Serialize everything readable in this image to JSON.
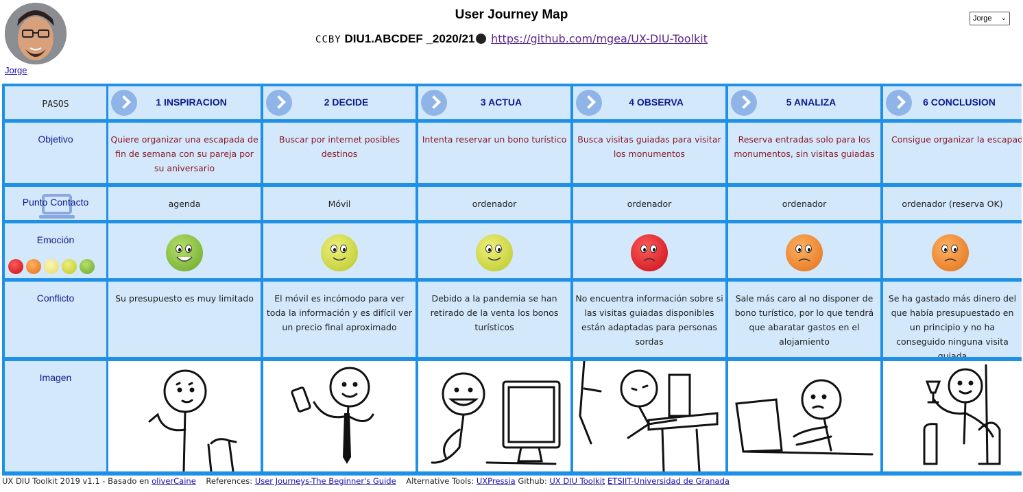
{
  "user": {
    "name": "Jorge",
    "selected": "Jorge"
  },
  "header": {
    "title": "User Journey Map",
    "cc": "CCBY",
    "code": "DIU1.ABCDEF _2020/21",
    "repo_link": "https://github.com/mgea/UX-DIU-Toolkit"
  },
  "rows": {
    "pasos": "PASOS",
    "objetivo": "Objetivo",
    "punto_contacto": "Punto Contacto",
    "emocion": "Emoción",
    "conflicto": "Conflicto",
    "imagen": "Imagen"
  },
  "steps": [
    {
      "label": "1 INSPIRACION",
      "objetivo": "Quiere organizar una escapada de fin de semana con su pareja por su aniversario",
      "contacto": "agenda",
      "emocion": "green",
      "conflicto": "Su presupuesto es muy limitado",
      "imagen": "thinking-person-icon"
    },
    {
      "label": "2 DECIDE",
      "objetivo": "Buscar por internet posibles destinos",
      "contacto": "Móvil",
      "emocion": "yellow",
      "conflicto": "El móvil es incómodo para ver toda la información y es difícil ver un precio final aproximado",
      "imagen": "phone-person-icon"
    },
    {
      "label": "3 ACTUA",
      "objetivo": "Intenta reservar un bono turístico",
      "contacto": "ordenador",
      "emocion": "yellow",
      "conflicto": "Debido a la pandemia se han retirado de la venta los bonos turísticos",
      "imagen": "computer-person-icon"
    },
    {
      "label": "4 OBSERVA",
      "objetivo": "Busca visitas guiadas para visitar los monumentos",
      "contacto": "ordenador",
      "emocion": "red",
      "conflicto": "No encuentra información sobre si las visitas guiadas disponibles están adaptadas para personas sordas",
      "imagen": "frustrated-person-icon"
    },
    {
      "label": "5 ANALIZA",
      "objetivo": "Reserva entradas solo para los monumentos, sin visitas guiadas",
      "contacto": "ordenador",
      "emocion": "orange",
      "conflicto": "Sale más caro al no disponer de bono turístico, por lo que tendrá que abaratar gastos en el alojamiento",
      "imagen": "laptop-person-icon"
    },
    {
      "label": "6 CONCLUSION",
      "objetivo": "Consigue organizar la escapada pero no como le hubiera gustado",
      "contacto": "ordenador (reserva OK)",
      "emocion": "orange",
      "conflicto": "Se ha gastado más dinero del que había presupuestado en un principio y no ha conseguido ninguna visita guiada",
      "imagen": "toasting-person-icon"
    }
  ],
  "emotion_scale": [
    "red",
    "orange",
    "light-yellow",
    "yellow",
    "green"
  ],
  "colors": {
    "grid_border": "#1e90e8",
    "cell_bg": "#d3e8fb",
    "label": "#0d1a8c",
    "objective_text": "#8b1a2a"
  },
  "footer": {
    "version": "UX DIU Toolkit 2019 v1.1 - Basado en",
    "based_link": "oliverCaine",
    "references_label": "References:",
    "references_link": "User Journeys-The Beginner's Guide",
    "alt_label": "Alternative Tools:",
    "alt_link": "UXPressia",
    "github_label": "Github:",
    "github_link": "UX DIU Toolkit",
    "univ_link": "ETSIIT-Universidad de Granada"
  }
}
